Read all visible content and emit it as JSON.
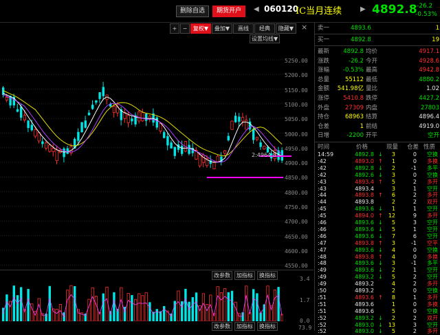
{
  "header": {
    "delete_btn": "删除自选",
    "futures_btn": "期货开户",
    "code": "060120",
    "name": "IC当月连续",
    "price": "4892.8",
    "change": "-26.2",
    "change_pct": "-0.53%",
    "prev_arrow": "◀",
    "next_arrow": "▶"
  },
  "toolbar": {
    "items": [
      "+",
      "−",
      "复权▼",
      "叠加▼",
      "画线",
      "经典",
      "隐藏▼"
    ],
    "close": "×",
    "settings_btn": "设置均线▼",
    "ma_label": "2:4964.8"
  },
  "price_axis": [
    "5250.00",
    "5200.00",
    "5150.00",
    "5100.00",
    "5050.00",
    "5000.00",
    "4950.00",
    "4900.00",
    "4850.00",
    "4800.00",
    "4750.00",
    "4700.00",
    "4650.00",
    "4600.00",
    "4550.00"
  ],
  "volume_panel": {
    "btn1": "改参数",
    "btn2": "加指标",
    "btn3": "换指标",
    "axis": [
      "3.4",
      "1.7",
      "0.0"
    ],
    "bottom_axis": "73.9"
  },
  "quote": {
    "sell1": {
      "label": "卖一",
      "price": "4893.6",
      "vol": "1"
    },
    "buy1": {
      "label": "买一",
      "price": "4892.8",
      "vol": "19"
    },
    "rows": [
      {
        "l1": "最新",
        "v1": "4892.8",
        "l2": "均价",
        "v2": "4917.1",
        "c1": "grn",
        "c2": "red"
      },
      {
        "l1": "涨跌",
        "v1": "-26.2",
        "l2": "今开",
        "v2": "4928.6",
        "c1": "grn",
        "c2": "red"
      },
      {
        "l1": "涨幅",
        "v1": "-0.53%",
        "l2": "最高",
        "v2": "4942.8",
        "c1": "grn",
        "c2": "red"
      },
      {
        "l1": "总量",
        "v1": "55112",
        "l2": "最低",
        "v2": "4880.2",
        "c1": "yel",
        "c2": "grn"
      },
      {
        "l1": "金额",
        "v1": "541.98亿",
        "l2": "量比",
        "v2": "1.02",
        "c1": "yel",
        "c2": "wht"
      },
      {
        "l1": "涨停",
        "v1": "5410.8",
        "l2": "跌停",
        "v2": "4427.2",
        "c1": "red",
        "c2": "grn"
      },
      {
        "l1": "外盘",
        "v1": "27309",
        "l2": "内盘",
        "v2": "27803",
        "c1": "red",
        "c2": "grn"
      },
      {
        "l1": "持仓",
        "v1": "68963",
        "l2": "结算",
        "v2": "4896.4",
        "c1": "yel",
        "c2": "wht"
      },
      {
        "l1": "仓差",
        "v1": "1",
        "l2": "前结",
        "v2": "4919.0",
        "c1": "yel",
        "c2": "wht"
      },
      {
        "l1": "日增",
        "v1": "-2200",
        "l2": "开平",
        "v2": "空开",
        "c1": "grn",
        "c2": "grn"
      }
    ]
  },
  "ticks": {
    "headers": [
      "时间",
      "价格",
      "现量",
      "仓差",
      "性质"
    ],
    "rows": [
      {
        "t": "14:59",
        "p": "4892.8",
        "a": "↓",
        "v": "3",
        "d": "0",
        "n": "空换",
        "pc": "grn",
        "nc": "grn"
      },
      {
        "t": ":42",
        "p": "4893.0",
        "a": "↑",
        "v": "1",
        "d": "0",
        "n": "多换",
        "pc": "red",
        "nc": "red"
      },
      {
        "t": ":42",
        "p": "4892.8",
        "a": "↓",
        "v": "2",
        "d": "-1",
        "n": "多平",
        "pc": "grn",
        "nc": "grn"
      },
      {
        "t": ":42",
        "p": "4892.6",
        "a": "↓",
        "v": "3",
        "d": "0",
        "n": "空换",
        "pc": "grn",
        "nc": "grn"
      },
      {
        "t": ":43",
        "p": "4893.4",
        "a": "↑",
        "v": "5",
        "d": "2",
        "n": "多开",
        "pc": "red",
        "nc": "red"
      },
      {
        "t": ":43",
        "p": "4893.4",
        "a": "",
        "v": "3",
        "d": "1",
        "n": "空开",
        "pc": "wht",
        "nc": "grn"
      },
      {
        "t": ":44",
        "p": "4893.8",
        "a": "↑",
        "v": "6",
        "d": "2",
        "n": "多开",
        "pc": "red",
        "nc": "red"
      },
      {
        "t": ":44",
        "p": "4893.8",
        "a": "",
        "v": "2",
        "d": "2",
        "n": "双开",
        "pc": "wht",
        "nc": "red"
      },
      {
        "t": ":45",
        "p": "4893.6",
        "a": "↓",
        "v": "1",
        "d": "1",
        "n": "空开",
        "pc": "grn",
        "nc": "grn"
      },
      {
        "t": ":45",
        "p": "4894.0",
        "a": "↑",
        "v": "12",
        "d": "9",
        "n": "多开",
        "pc": "red",
        "nc": "red"
      },
      {
        "t": ":46",
        "p": "4893.6",
        "a": "↓",
        "v": "5",
        "d": "3",
        "n": "空开",
        "pc": "grn",
        "nc": "grn"
      },
      {
        "t": ":46",
        "p": "4893.6",
        "a": "↓",
        "v": "5",
        "d": "1",
        "n": "空开",
        "pc": "grn",
        "nc": "grn"
      },
      {
        "t": ":46",
        "p": "4893.6",
        "a": "↓",
        "v": "7",
        "d": "6",
        "n": "空开",
        "pc": "grn",
        "nc": "grn"
      },
      {
        "t": ":47",
        "p": "4893.8",
        "a": "↑",
        "v": "3",
        "d": "-1",
        "n": "空平",
        "pc": "red",
        "nc": "red"
      },
      {
        "t": ":47",
        "p": "4893.6",
        "a": "↓",
        "v": "4",
        "d": "0",
        "n": "空换",
        "pc": "grn",
        "nc": "grn"
      },
      {
        "t": ":48",
        "p": "4893.8",
        "a": "↑",
        "v": "4",
        "d": "0",
        "n": "多换",
        "pc": "red",
        "nc": "red"
      },
      {
        "t": ":48",
        "p": "4893.6",
        "a": "↓",
        "v": "3",
        "d": "-1",
        "n": "多平",
        "pc": "grn",
        "nc": "grn"
      },
      {
        "t": ":49",
        "p": "4893.6",
        "a": "↓",
        "v": "2",
        "d": "1",
        "n": "空开",
        "pc": "grn",
        "nc": "grn"
      },
      {
        "t": ":49",
        "p": "4893.2",
        "a": "↓",
        "v": "5",
        "d": "2",
        "n": "空开",
        "pc": "grn",
        "nc": "grn"
      },
      {
        "t": ":49",
        "p": "4893.2",
        "a": "",
        "v": "4",
        "d": "2",
        "n": "多开",
        "pc": "wht",
        "nc": "red"
      },
      {
        "t": ":50",
        "p": "4893.2",
        "a": "",
        "v": "2",
        "d": "0",
        "n": "空换",
        "pc": "wht",
        "nc": "grn"
      },
      {
        "t": ":51",
        "p": "4893.6",
        "a": "↑",
        "v": "8",
        "d": "1",
        "n": "多开",
        "pc": "red",
        "nc": "red"
      },
      {
        "t": ":51",
        "p": "4893.6",
        "a": "",
        "v": "1",
        "d": "0",
        "n": "多换",
        "pc": "wht",
        "nc": "red"
      },
      {
        "t": ":51",
        "p": "4893.6",
        "a": "",
        "v": "5",
        "d": "0",
        "n": "空换",
        "pc": "wht",
        "nc": "grn"
      },
      {
        "t": ":52",
        "p": "4893.2",
        "a": "↓",
        "v": "2",
        "d": "2",
        "n": "双开",
        "pc": "grn",
        "nc": "red"
      },
      {
        "t": ":52",
        "p": "4893.0",
        "a": "↓",
        "v": "13",
        "d": "3",
        "n": "空开",
        "pc": "grn",
        "nc": "grn"
      },
      {
        "t": ":52",
        "p": "4893.0",
        "a": "↓",
        "v": "5",
        "d": "2",
        "n": "多开",
        "pc": "grn",
        "nc": "red"
      }
    ]
  },
  "colors": {
    "up": "#ff3030",
    "down": "#00e5e5",
    "ma1": "#ffffff",
    "ma2": "#e0e000",
    "ma3": "#b040ff",
    "level": "#ff00ff"
  }
}
